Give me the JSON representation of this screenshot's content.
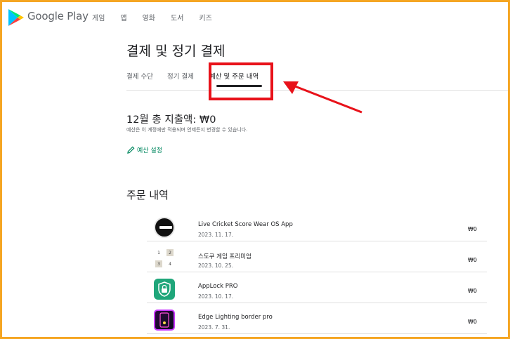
{
  "header": {
    "brand": "Google Play",
    "nav": [
      "게임",
      "앱",
      "영화",
      "도서",
      "키즈"
    ]
  },
  "page": {
    "title": "결제 및 정기 결제"
  },
  "tabs": [
    {
      "label": "결제 수단"
    },
    {
      "label": "정기 결제"
    },
    {
      "label": "예산 및 주문 내역",
      "active": true
    }
  ],
  "spend": {
    "title": "12월 총 지출액: ₩0",
    "subtitle": "예산은 이 계정에만 적용되며 언제든지 변경할 수 있습니다.",
    "budget_link": "예산 설정"
  },
  "orders": {
    "title": "주문 내역",
    "items": [
      {
        "name": "Live Cricket Score Wear OS App",
        "date": "2023. 11. 17.",
        "price": "₩0",
        "icon": "watch-icon"
      },
      {
        "name": "스도쿠 게임 프리미엄",
        "date": "2023. 10. 25.",
        "price": "₩0",
        "icon": "sudoku-icon"
      },
      {
        "name": "AppLock PRO",
        "date": "2023. 10. 17.",
        "price": "₩0",
        "icon": "lock-icon"
      },
      {
        "name": "Edge Lighting border pro",
        "date": "2023. 7. 31.",
        "price": "₩0",
        "icon": "edge-lighting-icon"
      }
    ]
  },
  "colors": {
    "frame_border": "#f5a623",
    "annotation_red": "#e8121a",
    "accent_green": "#01875f"
  }
}
